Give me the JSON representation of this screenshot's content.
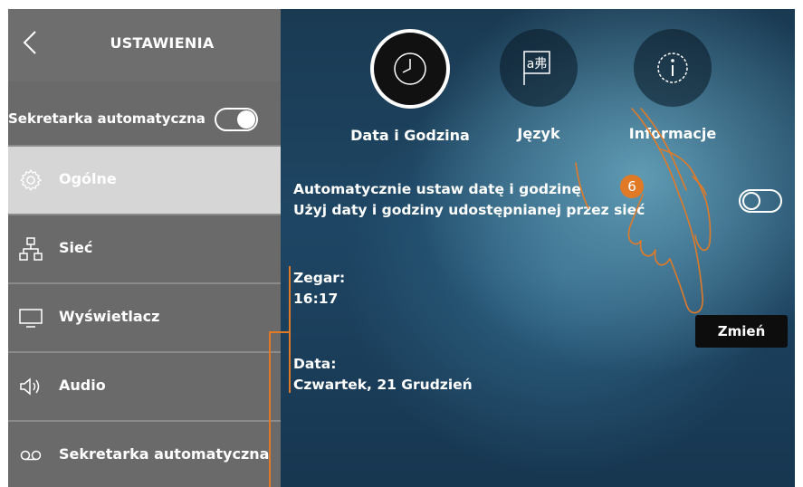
{
  "sidebar": {
    "title": "USTAWIENIA",
    "toggle": {
      "label": "Sekretarka automatyczna",
      "state": "on"
    },
    "items": [
      {
        "label": "Ogólne",
        "icon": "gear-icon",
        "active": true
      },
      {
        "label": "Sieć",
        "icon": "network-icon",
        "active": false
      },
      {
        "label": "Wyświetlacz",
        "icon": "monitor-icon",
        "active": false
      },
      {
        "label": "Audio",
        "icon": "speaker-icon",
        "active": false
      },
      {
        "label": "Sekretarka automatyczna",
        "icon": "voicemail-icon",
        "active": false
      }
    ]
  },
  "tabs": [
    {
      "label": "Data i Godzina",
      "icon": "clock-icon",
      "active": true
    },
    {
      "label": "Język",
      "icon": "language-icon",
      "glyph": "a弗",
      "active": false
    },
    {
      "label": "Informacje",
      "icon": "info-icon",
      "active": false
    }
  ],
  "auto_datetime": {
    "line1": "Automatycznie ustaw datę i godzinę",
    "line2": "Użyj daty i godziny udostępnianej przez sieć",
    "state": "off"
  },
  "clock": {
    "label": "Zegar:",
    "value": "16:17"
  },
  "date": {
    "label": "Data:",
    "value": "Czwartek, 21 Grudzień"
  },
  "change_button": "Zmień",
  "step_badge": "6",
  "colors": {
    "accent": "#e07a27",
    "sidebar": "#6a6a6a",
    "active_item": "#d6d6d6",
    "background": "#1b3d57"
  }
}
